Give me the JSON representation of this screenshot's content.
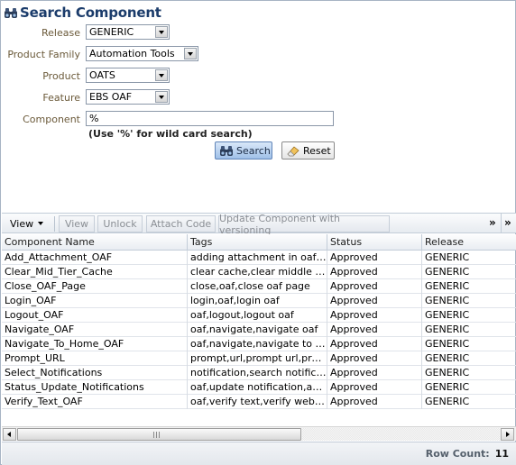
{
  "search": {
    "title": "Search Component",
    "release_label": "Release",
    "release_value": "GENERIC",
    "product_family_label": "Product Family",
    "product_family_value": "Automation Tools",
    "product_label": "Product",
    "product_value": "OATS",
    "feature_label": "Feature",
    "feature_value": "EBS OAF",
    "component_label": "Component",
    "component_value": "%",
    "hint": "(Use '%' for wild card search)",
    "search_button": "Search",
    "reset_button": "Reset"
  },
  "toolbar": {
    "view_menu": "View",
    "view_button": "View",
    "unlock_button": "Unlock",
    "attach_code_button": "Attach Code",
    "update_button": "Update Component with versioning",
    "more_glyph": "»",
    "detach_glyph": "»"
  },
  "table": {
    "columns": [
      "Component Name",
      "Tags",
      "Status",
      "Release"
    ],
    "rows": [
      [
        "Add_Attachment_OAF",
        "adding attachment in oaf pag…",
        "Approved",
        "GENERIC"
      ],
      [
        "Clear_Mid_Tier_Cache",
        "clear cache,clear middle tier c…",
        "Approved",
        "GENERIC"
      ],
      [
        "Close_OAF_Page",
        "close,oaf,close oaf page",
        "Approved",
        "GENERIC"
      ],
      [
        "Login_OAF",
        "login,oaf,login oaf",
        "Approved",
        "GENERIC"
      ],
      [
        "Logout_OAF",
        "oaf,logout,logout oaf",
        "Approved",
        "GENERIC"
      ],
      [
        "Navigate_OAF",
        "oaf,navigate,navigate oaf",
        "Approved",
        "GENERIC"
      ],
      [
        "Navigate_To_Home_OAF",
        "oaf,navigate,navigate to home",
        "Approved",
        "GENERIC"
      ],
      [
        "Prompt_URL",
        "prompt,url,prompt url,prompt…",
        "Approved",
        "GENERIC"
      ],
      [
        "Select_Notifications",
        "notification,search notificatio…",
        "Approved",
        "GENERIC"
      ],
      [
        "Status_Update_Notifications",
        "oaf,update notification,appr…",
        "Approved",
        "GENERIC"
      ],
      [
        "Verify_Text_OAF",
        "oaf,verify text,verify web te…",
        "Approved",
        "GENERIC"
      ]
    ]
  },
  "footer": {
    "row_count_label": "Row Count:",
    "row_count_value": "11"
  },
  "colors": {
    "title": "#1b3c6b",
    "field_label": "#6b5a3a",
    "search_button": "#9fc0e8"
  },
  "icons": [
    "binoculars-icon",
    "eraser-icon",
    "chevron-down-icon",
    "double-chevron-right-icon"
  ]
}
